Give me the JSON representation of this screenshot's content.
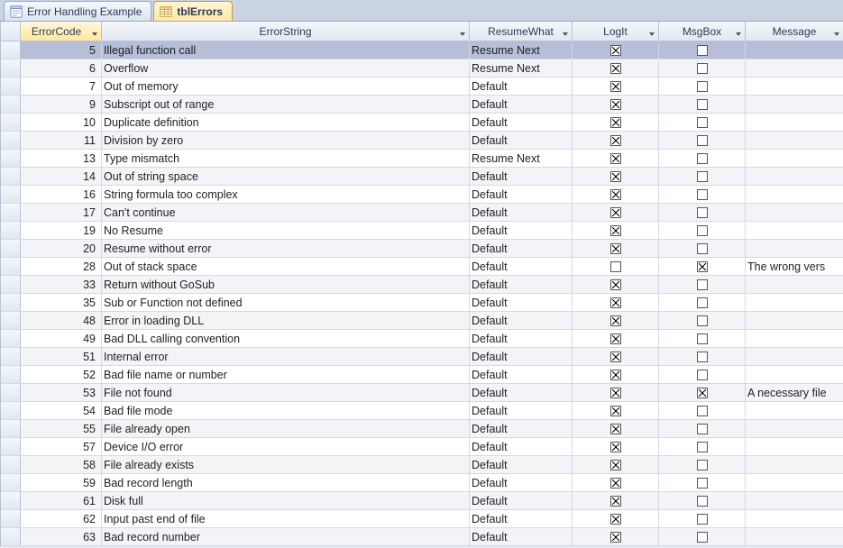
{
  "tabs": [
    {
      "label": "Error Handling Example",
      "active": false,
      "icon": "form"
    },
    {
      "label": "tblErrors",
      "active": true,
      "icon": "table"
    }
  ],
  "columns": {
    "rowselector": "",
    "errorcode": "ErrorCode",
    "errorstring": "ErrorString",
    "resumewhat": "ResumeWhat",
    "logit": "LogIt",
    "msgbox": "MsgBox",
    "message": "Message"
  },
  "rows": [
    {
      "code": 5,
      "string": "Illegal function call",
      "resume": "Resume Next",
      "logit": true,
      "msgbox": false,
      "message": "",
      "selected": true
    },
    {
      "code": 6,
      "string": "Overflow",
      "resume": "Resume Next",
      "logit": true,
      "msgbox": false,
      "message": ""
    },
    {
      "code": 7,
      "string": "Out of memory",
      "resume": "Default",
      "logit": true,
      "msgbox": false,
      "message": ""
    },
    {
      "code": 9,
      "string": "Subscript out of range",
      "resume": "Default",
      "logit": true,
      "msgbox": false,
      "message": ""
    },
    {
      "code": 10,
      "string": "Duplicate definition",
      "resume": "Default",
      "logit": true,
      "msgbox": false,
      "message": ""
    },
    {
      "code": 11,
      "string": "Division by zero",
      "resume": "Default",
      "logit": true,
      "msgbox": false,
      "message": ""
    },
    {
      "code": 13,
      "string": "Type mismatch",
      "resume": "Resume Next",
      "logit": true,
      "msgbox": false,
      "message": ""
    },
    {
      "code": 14,
      "string": "Out of string space",
      "resume": "Default",
      "logit": true,
      "msgbox": false,
      "message": ""
    },
    {
      "code": 16,
      "string": "String formula too complex",
      "resume": "Default",
      "logit": true,
      "msgbox": false,
      "message": ""
    },
    {
      "code": 17,
      "string": "Can't continue",
      "resume": "Default",
      "logit": true,
      "msgbox": false,
      "message": ""
    },
    {
      "code": 19,
      "string": "No Resume",
      "resume": "Default",
      "logit": true,
      "msgbox": false,
      "message": ""
    },
    {
      "code": 20,
      "string": "Resume without error",
      "resume": "Default",
      "logit": true,
      "msgbox": false,
      "message": ""
    },
    {
      "code": 28,
      "string": "Out of stack space",
      "resume": "Default",
      "logit": false,
      "msgbox": true,
      "message": "The wrong vers"
    },
    {
      "code": 33,
      "string": "Return without GoSub",
      "resume": "Default",
      "logit": true,
      "msgbox": false,
      "message": ""
    },
    {
      "code": 35,
      "string": "Sub or Function not defined",
      "resume": "Default",
      "logit": true,
      "msgbox": false,
      "message": ""
    },
    {
      "code": 48,
      "string": "Error in loading DLL",
      "resume": "Default",
      "logit": true,
      "msgbox": false,
      "message": ""
    },
    {
      "code": 49,
      "string": "Bad DLL calling convention",
      "resume": "Default",
      "logit": true,
      "msgbox": false,
      "message": ""
    },
    {
      "code": 51,
      "string": "Internal error",
      "resume": "Default",
      "logit": true,
      "msgbox": false,
      "message": ""
    },
    {
      "code": 52,
      "string": "Bad file name or number",
      "resume": "Default",
      "logit": true,
      "msgbox": false,
      "message": ""
    },
    {
      "code": 53,
      "string": "File not found",
      "resume": "Default",
      "logit": true,
      "msgbox": true,
      "message": "A necessary file"
    },
    {
      "code": 54,
      "string": "Bad file mode",
      "resume": "Default",
      "logit": true,
      "msgbox": false,
      "message": ""
    },
    {
      "code": 55,
      "string": "File already open",
      "resume": "Default",
      "logit": true,
      "msgbox": false,
      "message": ""
    },
    {
      "code": 57,
      "string": "Device I/O error",
      "resume": "Default",
      "logit": true,
      "msgbox": false,
      "message": ""
    },
    {
      "code": 58,
      "string": "File already exists",
      "resume": "Default",
      "logit": true,
      "msgbox": false,
      "message": ""
    },
    {
      "code": 59,
      "string": "Bad record length",
      "resume": "Default",
      "logit": true,
      "msgbox": false,
      "message": ""
    },
    {
      "code": 61,
      "string": "Disk full",
      "resume": "Default",
      "logit": true,
      "msgbox": false,
      "message": ""
    },
    {
      "code": 62,
      "string": "Input past end of file",
      "resume": "Default",
      "logit": true,
      "msgbox": false,
      "message": ""
    },
    {
      "code": 63,
      "string": "Bad record number",
      "resume": "Default",
      "logit": true,
      "msgbox": false,
      "message": ""
    }
  ]
}
